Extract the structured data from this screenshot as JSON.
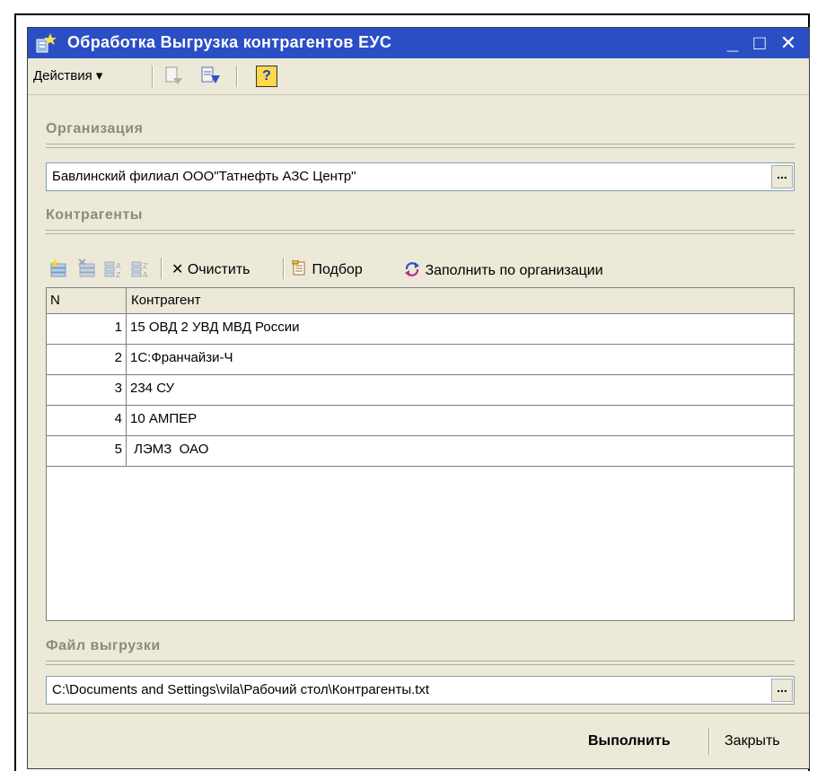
{
  "window": {
    "title": "Обработка Выгрузка контрагентов ЕУС",
    "minimize": "_",
    "maximize": "□",
    "close": "✕"
  },
  "toolbar": {
    "actions_label": "Действия ▾",
    "help": "?"
  },
  "organization": {
    "section_label": "Организация",
    "value": "Бавлинский филиал ООО\"Татнефть АЗС Центр\"",
    "choose_button": "..."
  },
  "counterparties": {
    "section_label": "Контрагенты",
    "clear_label": "Очистить",
    "selection_label": "Подбор",
    "fill_label": "Заполнить по организации",
    "columns": [
      "N",
      "Контрагент"
    ],
    "rows": [
      {
        "n": "1",
        "name": "15 ОВД 2 УВД МВД России"
      },
      {
        "n": "2",
        "name": "1С:Франчайзи-Ч"
      },
      {
        "n": "3",
        "name": "234 СУ"
      },
      {
        "n": "4",
        "name": "10 АМПЕР"
      },
      {
        "n": "5",
        "name": " ЛЭМЗ  ОАО"
      }
    ]
  },
  "export_file": {
    "section_label": "Файл выгрузки",
    "value": "C:\\Documents and Settings\\vila\\Рабочий стол\\Контрагенты.txt",
    "choose_button": "..."
  },
  "footer": {
    "execute_label": "Выполнить",
    "close_label": "Закрыть"
  },
  "colors": {
    "titlebar": "#2a4ec4",
    "window_bg": "#ece9d8",
    "section_text": "#8c8a80"
  }
}
